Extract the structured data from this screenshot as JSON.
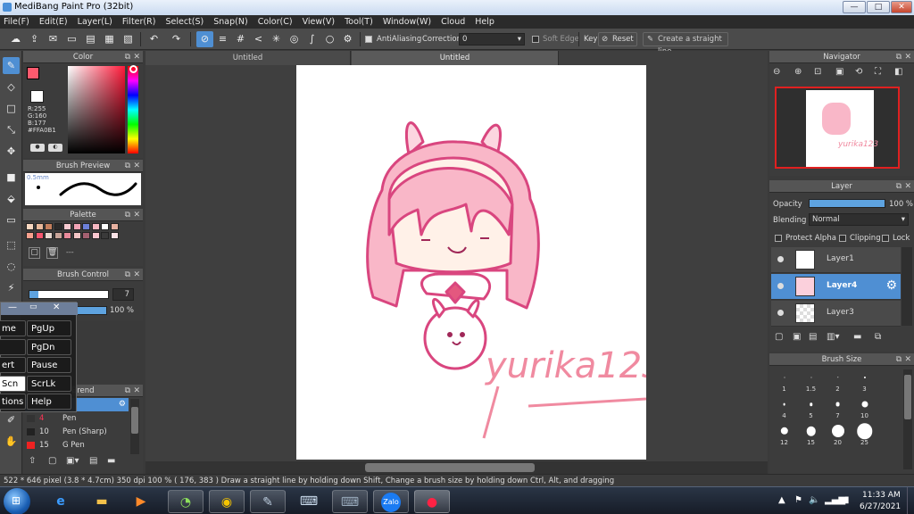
{
  "window": {
    "title": "MediBang Paint Pro (32bit)",
    "min": "—",
    "max": "□",
    "close": "✕"
  },
  "menu": [
    "File(F)",
    "Edit(E)",
    "Layer(L)",
    "Filter(R)",
    "Select(S)",
    "Snap(N)",
    "Color(C)",
    "View(V)",
    "Tool(T)",
    "Window(W)",
    "Cloud",
    "Help"
  ],
  "toolbar": {
    "antialiasing_label": "AntiAliasing",
    "correction_label": "Correction",
    "correction_value": "0",
    "soft_edge_label": "Soft Edge",
    "key_label": "Key",
    "reset_label": "Reset",
    "straight_line_label": "Create a straight line"
  },
  "color_panel": {
    "title": "Color",
    "r": "R:255",
    "g": "G:160",
    "b": "B:177",
    "hex": "#FFA0B1",
    "primary": "#ff5a6e",
    "secondary": "#ffffff"
  },
  "brush_preview": {
    "title": "Brush Preview",
    "size": "0.5mm"
  },
  "palette": {
    "title": "Palette",
    "colors": [
      "#f8d7c0",
      "#e8b89a",
      "#c47f5d",
      "#2a2a2a",
      "#f6c9d0",
      "#f0a3b5",
      "#6c7fd8",
      "#f4b6c0",
      "#ffffff",
      "#e6b0a0",
      "#f7a08d",
      "#f5576f",
      "#e8d8d0",
      "#c9a59a",
      "#e88a9a",
      "#f3c5c5",
      "#a46070",
      "#f9c7cf",
      "#3a3a3a",
      "#fbe2e6"
    ],
    "more": "---"
  },
  "brush_control": {
    "title": "Brush Control",
    "size_value": "7",
    "opacity_value": "100 %"
  },
  "brush_list": {
    "title": "Brend",
    "items": [
      {
        "size": "",
        "name": "il"
      },
      {
        "size": "4",
        "name": "Pen"
      },
      {
        "size": "10",
        "name": "Pen (Sharp)"
      },
      {
        "size": "15",
        "name": "G Pen"
      }
    ]
  },
  "osk": {
    "keys": [
      "me",
      "PgUp",
      "PgDn",
      "ert",
      "Pause",
      "Scn",
      "ScrLk",
      "tions",
      "Help"
    ]
  },
  "doc_tabs": [
    "Untitled",
    "Untitled"
  ],
  "artwork": {
    "signature": "yurika123"
  },
  "navigator": {
    "title": "Navigator"
  },
  "layer_panel": {
    "title": "Layer",
    "opacity_label": "Opacity",
    "opacity_value": "100 %",
    "blending_label": "Blending",
    "blending_value": "Normal",
    "protect_alpha": "Protect Alpha",
    "clipping": "Clipping",
    "lock": "Lock",
    "layers": [
      "Layer1",
      "Layer4",
      "Layer3"
    ]
  },
  "brush_size": {
    "title": "Brush Size",
    "sizes": [
      "1",
      "1.5",
      "2",
      "3",
      "4",
      "5",
      "7",
      "10",
      "12",
      "15",
      "20",
      "25"
    ]
  },
  "status": {
    "text": "522 * 646 pixel  (3.8 * 4.7cm)  350 dpi  100 %  ( 176, 383 )  Draw a straight line by holding down Shift, Change a brush size by holding down Ctrl, Alt, and dragging"
  },
  "taskbar": {
    "time": "11:33 AM",
    "date": "6/27/2021",
    "zalo": "Zalo"
  }
}
